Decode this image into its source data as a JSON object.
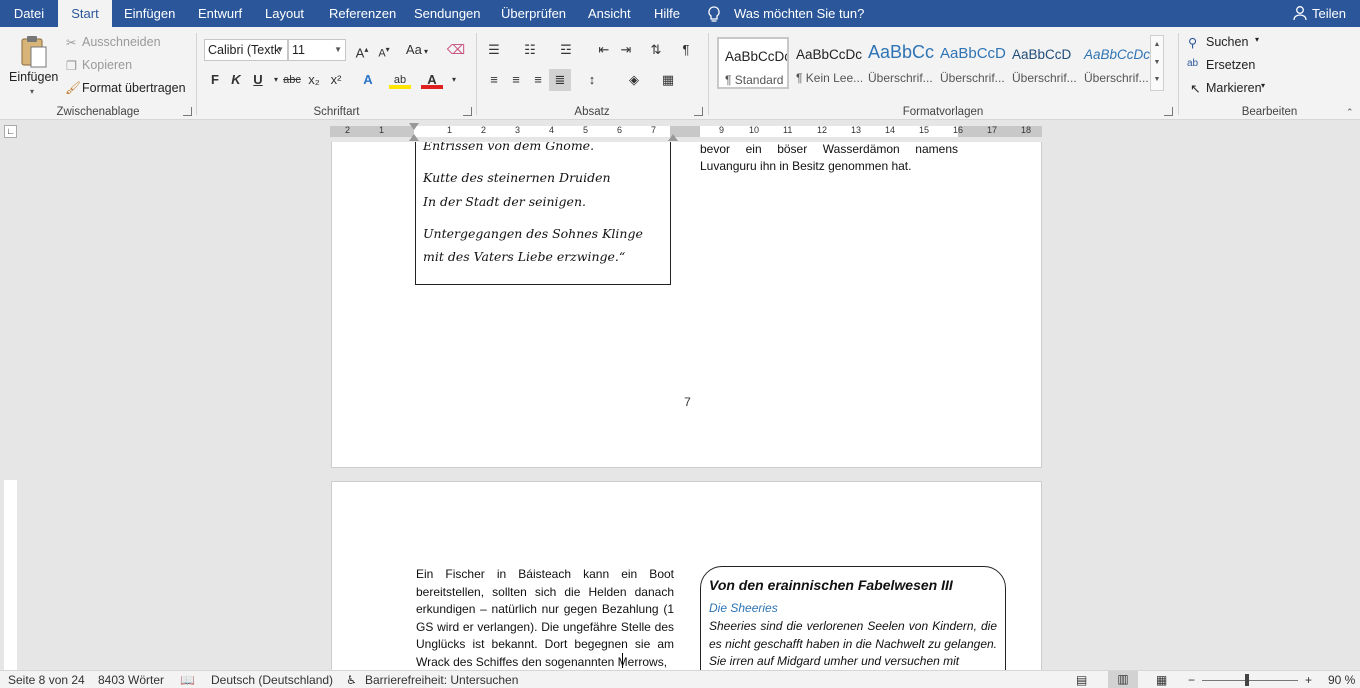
{
  "menu": {
    "tabs": [
      "Datei",
      "Start",
      "Einfügen",
      "Entwurf",
      "Layout",
      "Referenzen",
      "Sendungen",
      "Überprüfen",
      "Ansicht",
      "Hilfe"
    ],
    "active": "Start",
    "tell_me": "Was möchten Sie tun?",
    "share": "Teilen"
  },
  "ribbon": {
    "clipboard": {
      "paste": "Einfügen",
      "cut": "Ausschneiden",
      "copy": "Kopieren",
      "format_painter": "Format übertragen",
      "label": "Zwischenablage"
    },
    "font": {
      "font_name": "Calibri (Textk",
      "font_size": "11",
      "bold": "F",
      "italic": "K",
      "underline": "U",
      "strike": "abc",
      "subscript": "x₂",
      "superscript": "x²",
      "case": "Aa",
      "label": "Schriftart"
    },
    "paragraph": {
      "label": "Absatz"
    },
    "styles": {
      "label": "Formatvorlagen",
      "items": [
        {
          "preview": "AaBbCcDc",
          "name": "¶ Standard"
        },
        {
          "preview": "AaBbCcDc",
          "name": "¶ Kein Lee..."
        },
        {
          "preview": "AaBbCc",
          "name": "Überschrif..."
        },
        {
          "preview": "AaBbCcD",
          "name": "Überschrif..."
        },
        {
          "preview": "AaBbCcD",
          "name": "Überschrif..."
        },
        {
          "preview": "AaBbCcDc",
          "name": "Überschrif..."
        }
      ]
    },
    "editing": {
      "find": "Suchen",
      "replace": "Ersetzen",
      "select": "Markieren",
      "label": "Bearbeiten"
    }
  },
  "ruler": {
    "labels": [
      "2",
      "1",
      "1",
      "2",
      "3",
      "4",
      "5",
      "6",
      "7",
      "9",
      "10",
      "11",
      "12",
      "13",
      "14",
      "15",
      "16",
      "17",
      "18"
    ]
  },
  "document": {
    "page7": {
      "poem_top": "Entrissen von dem Gnome.",
      "poem_lines": [
        "Kutte des steinernen Druiden",
        "In der Stadt der seinigen.",
        "Untergegangen des Sohnes Klinge",
        "mit des Vaters Liebe erzwinge.“"
      ],
      "right_line1": "bevor ein böser Wasserdämon namens",
      "right_line2": "Luvanguru ihn in Besitz genommen hat.",
      "page_number": "7"
    },
    "page8": {
      "left_para": "Ein Fischer in Báisteach kann ein Boot bereitstellen, sollten sich die Helden danach erkundigen – natürlich nur gegen Bezahlung (1 GS wird er verlangen). Die ungefähre Stelle des Unglücks ist bekannt. Dort begegnen sie am Wrack des Schiffes den sogenannten Merrows,",
      "box_title": "Von den erainnischen Fabelwesen III",
      "box_subtitle": "Die Sheeries",
      "box_text": "Sheeries sind die verlorenen Seelen von Kindern, die es nicht geschafft haben in die Nachwelt zu gelangen. Sie irren auf Midgard umher und versuchen mit"
    }
  },
  "status": {
    "page": "Seite 8 von 24",
    "words": "8403 Wörter",
    "language": "Deutsch (Deutschland)",
    "accessibility": "Barrierefreiheit: Untersuchen",
    "zoom": "90 %",
    "zoom_level": 0.9
  },
  "colors": {
    "accent": "#2b579a",
    "subtitle": "#2e74b5"
  }
}
